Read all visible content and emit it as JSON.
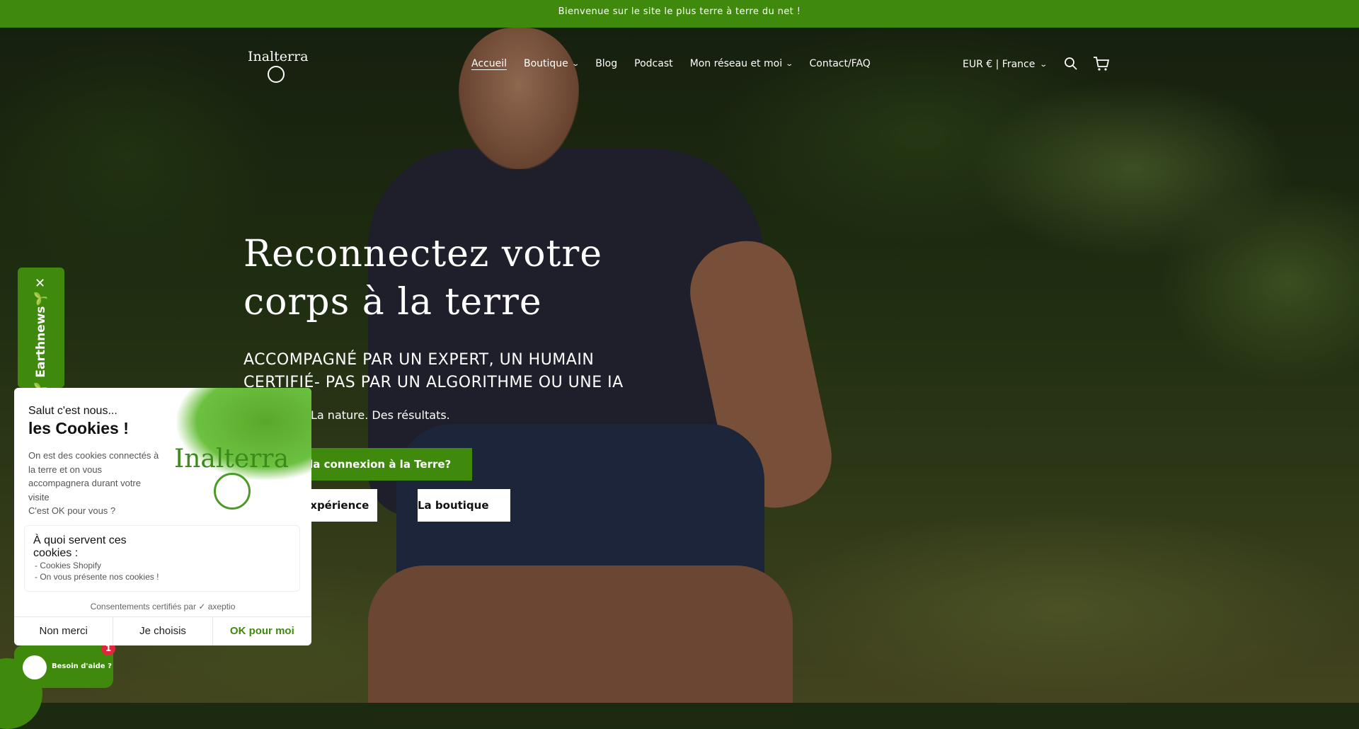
{
  "announcement": "Bienvenue sur le site le plus terre à terre du net !",
  "header": {
    "logo_text": "Inalterra",
    "nav": [
      {
        "label": "Accueil",
        "active": true
      },
      {
        "label": "Boutique",
        "dropdown": true
      },
      {
        "label": "Blog"
      },
      {
        "label": "Podcast"
      },
      {
        "label": "Mon réseau et moi",
        "dropdown": true
      },
      {
        "label": "Contact/FAQ"
      }
    ],
    "currency": "EUR € | France",
    "icons": [
      "search-icon",
      "cart-icon"
    ]
  },
  "hero": {
    "title_line1": "Reconnectez votre",
    "title_line2": "corps à la terre",
    "subtitle": "ACCOMPAGNÉ PAR UN EXPERT, UN HUMAIN CERTIFIÉ- PAS PAR UN ALGORITHME OU UNE IA",
    "tagline": "La nature. Des résultats.",
    "btn_primary": "ce que la connexion à la Terre?",
    "btn_experience": "ncer l'expérience",
    "btn_shop": "La boutique"
  },
  "earthnews": {
    "label": "🌱 Earthnews🌱",
    "close": "✕"
  },
  "cookie": {
    "greeting": "Salut c'est nous...",
    "title": "les Cookies !",
    "body": "On est des cookies connectés à la terre et on vous accompagnera durant votre visite",
    "question": "C'est OK pour vous ?",
    "logo_text": "Inalterra",
    "info_title": "À quoi servent ces cookies :",
    "info_items": [
      "- Cookies Shopify",
      "- On vous présente nos cookies !"
    ],
    "certified": "Consentements certifiés par ✓ axeptio",
    "btn_no": "Non merci",
    "btn_choose": "Je choisis",
    "btn_ok": "OK pour moi"
  },
  "help": {
    "label": "Besoin d'aide ?",
    "badge": "1"
  },
  "colors": {
    "brand_green": "#3f8a0c",
    "badge_red": "#e0263a"
  }
}
